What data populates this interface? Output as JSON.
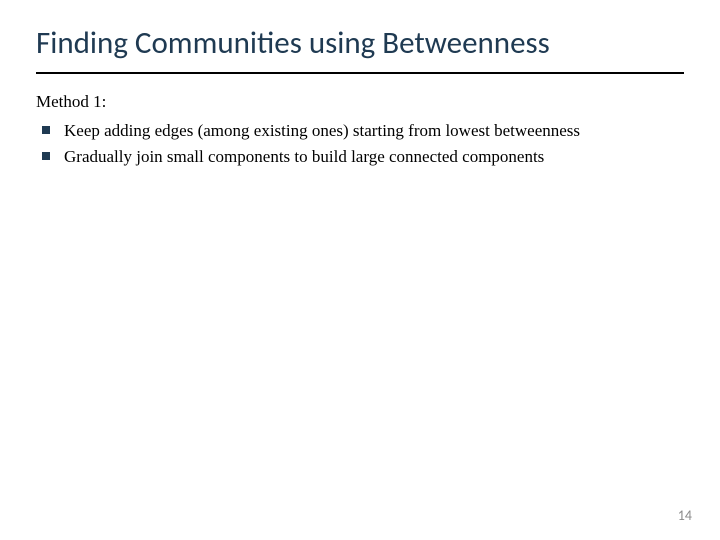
{
  "slide": {
    "title": "Finding Communities using Betweenness",
    "method_label": "Method 1:",
    "bullets": [
      "Keep adding edges (among existing ones) starting from lowest betweenness",
      "Gradually join small components to build large connected components"
    ],
    "page_number": "14"
  }
}
